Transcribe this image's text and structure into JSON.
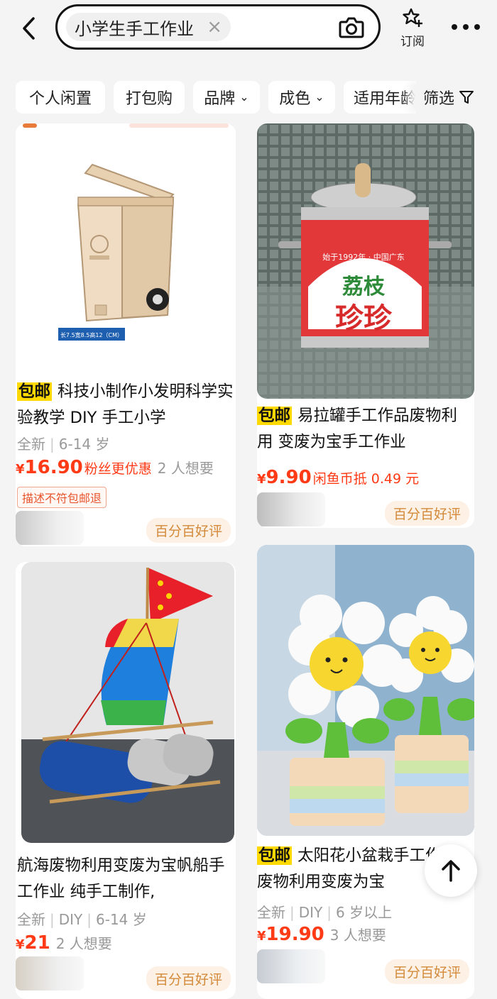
{
  "search": {
    "query": "小学生手工作业",
    "clear": "×"
  },
  "header": {
    "subscribe_label": "订阅"
  },
  "filters": [
    {
      "label": "个人闲置",
      "chevron": ""
    },
    {
      "label": "打包购",
      "chevron": ""
    },
    {
      "label": "品牌",
      "chevron": "⌄"
    },
    {
      "label": "成色",
      "chevron": "⌄"
    },
    {
      "label": "适用年龄",
      "chevron": ""
    }
  ],
  "filter_button": {
    "label": "筛选"
  },
  "products": [
    {
      "tag": "包邮",
      "title": "科技小制作小发明科学实验教学 DIY 手工小学",
      "meta": [
        "全新",
        "6-14 岁"
      ],
      "price_yen": "¥",
      "price": "16.90",
      "price_extra": "粉丝更优惠",
      "want": "2 人想要",
      "notice": "描述不符包邮退",
      "rating": "百分百好评",
      "image_caption": "长7.5宽8.5高12（CM）"
    },
    {
      "tag": "包邮",
      "title": "易拉罐手工作品废物利用 变废为宝手工作业",
      "meta": [],
      "price_yen": "¥",
      "price": "9.90",
      "price_extra": "闲鱼币抵 0.49 元",
      "want": "",
      "rating": "百分百好评",
      "image_text": [
        "始于1992年 · 中国广东",
        "荔枝",
        "珍珍"
      ]
    },
    {
      "tag": "",
      "title": "航海废物利用变废为宝帆船手工作业 纯手工制作,",
      "meta": [
        "全新",
        "DIY",
        "6-14 岁"
      ],
      "price_yen": "¥",
      "price": "21",
      "price_extra": "",
      "want": "2 人想要",
      "rating": "百分百好评"
    },
    {
      "tag": "包邮",
      "title": "太阳花小盆栽手工作品废物利用变废为宝",
      "meta": [
        "全新",
        "DIY",
        "6 岁以上"
      ],
      "price_yen": "¥",
      "price": "19.90",
      "price_extra": "",
      "want": "3 人想要",
      "rating": "百分百好评"
    }
  ],
  "colors": {
    "price": "#ff3a16",
    "tag_bg": "#ffd900",
    "rating": "#d38a3a"
  }
}
